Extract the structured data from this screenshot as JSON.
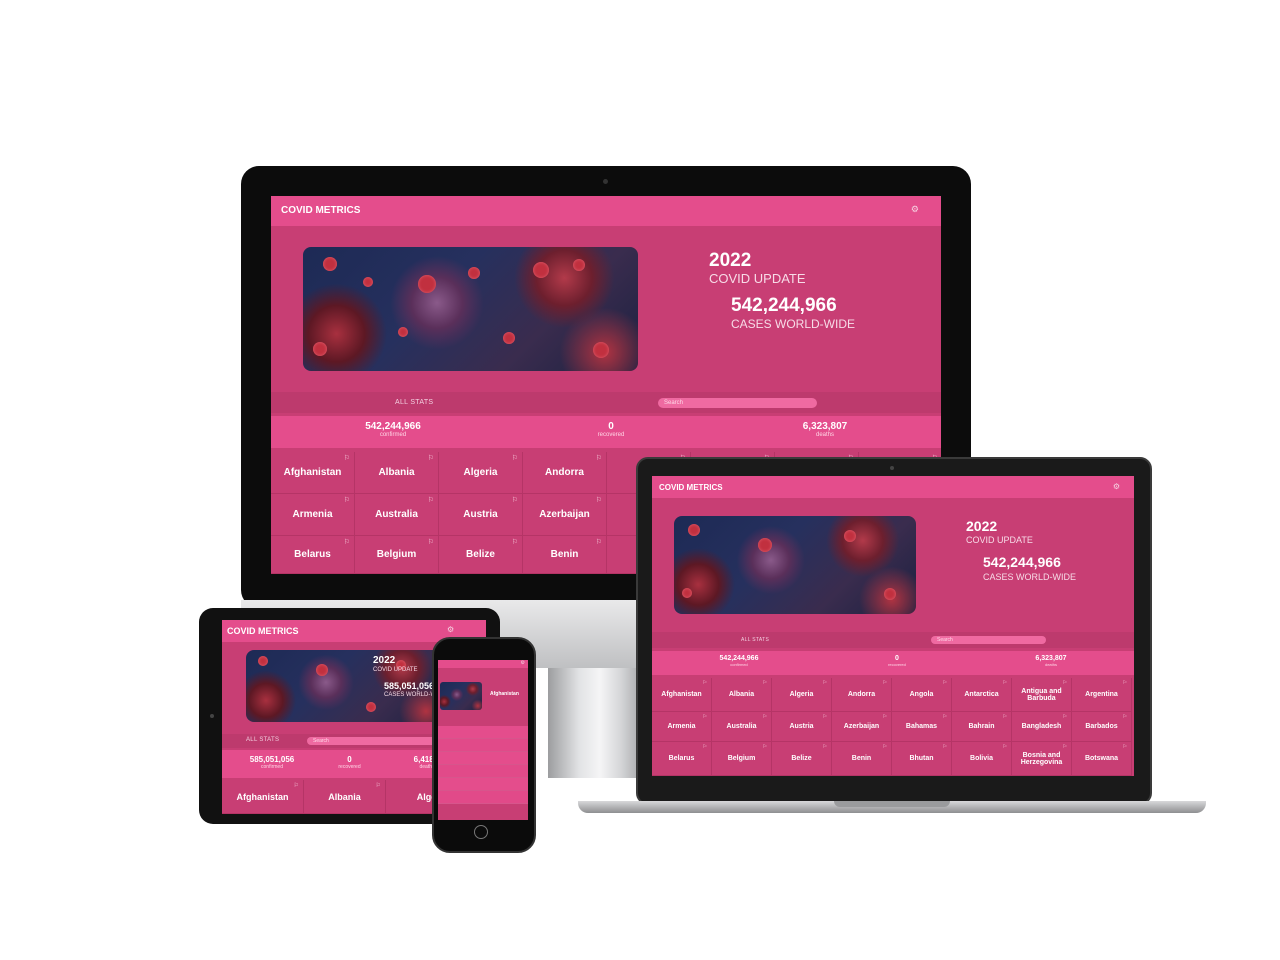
{
  "brand": "COVID METRICS",
  "gear_icon": "gear-icon",
  "hero": {
    "year": "2022",
    "subtitle": "COVID UPDATE",
    "cases": "542,244,966",
    "cases_caption": "CASES WORLD-WIDE"
  },
  "tabs": {
    "all_stats": "ALL STATS",
    "search_placeholder": "Search"
  },
  "stats": {
    "confirmed": "542,244,966",
    "confirmed_label": "confirmed",
    "recovered": "0",
    "recovered_label": "recovered",
    "deaths": "6,323,807",
    "deaths_label": "deaths"
  },
  "tablet": {
    "year": "2022",
    "subtitle": "COVID UPDATE",
    "cases": "585,051,056",
    "cases_caption": "CASES WORLD-WIDE",
    "confirmed": "585,051,056",
    "confirmed_label": "confirmed",
    "recovered": "0",
    "recovered_label": "recovered",
    "deaths": "6,418,3",
    "deaths_label": "deaths",
    "countries": [
      "Afghanistan",
      "Albania",
      "Alge"
    ]
  },
  "phone": {
    "country": "Afghanistan"
  },
  "imac_countries": [
    [
      "Afghanistan",
      "Albania",
      "Algeria",
      "Andorra",
      "A"
    ],
    [
      "Armenia",
      "Australia",
      "Austria",
      "Azerbaijan",
      "Ba"
    ],
    [
      "Belarus",
      "Belgium",
      "Belize",
      "Benin",
      "B"
    ]
  ],
  "laptop_countries": [
    [
      "Afghanistan",
      "Albania",
      "Algeria",
      "Andorra",
      "Angola",
      "Antarctica",
      "Antigua and Barbuda",
      "Argentina"
    ],
    [
      "Armenia",
      "Australia",
      "Austria",
      "Azerbaijan",
      "Bahamas",
      "Bahrain",
      "Bangladesh",
      "Barbados"
    ],
    [
      "Belarus",
      "Belgium",
      "Belize",
      "Benin",
      "Bhutan",
      "Bolivia",
      "Bosnia and Herzegovina",
      "Botswana"
    ]
  ]
}
